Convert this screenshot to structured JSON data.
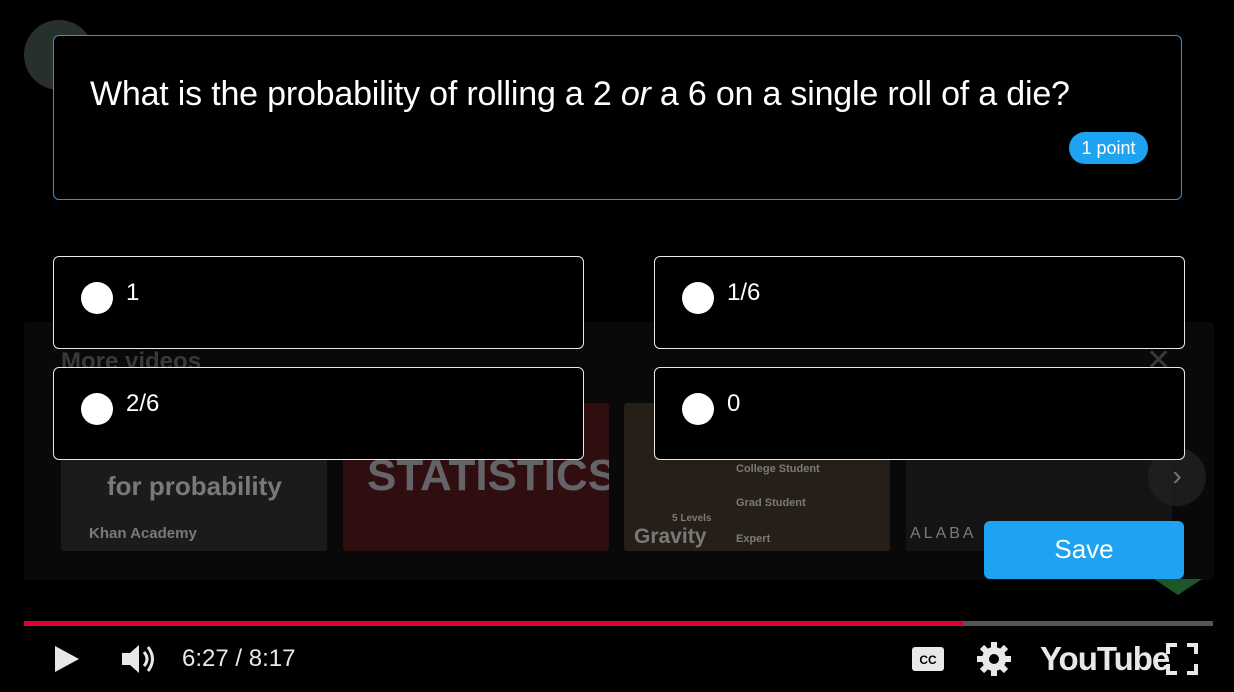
{
  "quiz": {
    "question_parts": {
      "before": "What is the probability of rolling a 2 ",
      "emphasis": "or",
      "after": " a 6 on a single roll of a die?"
    },
    "points": "1 point",
    "options": [
      {
        "label": "1"
      },
      {
        "label": "1/6"
      },
      {
        "label": "2/6"
      },
      {
        "label": "0"
      }
    ],
    "save_label": "Save"
  },
  "background_video": {
    "more_videos_title": "More videos",
    "thumbnails": [
      {
        "title": "for probability",
        "channel": "Khan Academy"
      },
      {
        "title": "STATISTICS?"
      },
      {
        "title": "Gravity",
        "levels": [
          "College Student",
          "Grad Student",
          "Expert"
        ],
        "badge": "5 Levels"
      },
      {
        "title": "ALABA"
      }
    ]
  },
  "player": {
    "time_display": "6:27 / 8:17",
    "brand": "YouTube",
    "progress_fraction": 0.79,
    "accent_color": "#e1002d",
    "icons": [
      "play-icon",
      "volume-icon",
      "captions-icon",
      "settings-gear-icon",
      "fullscreen-icon"
    ]
  },
  "colors": {
    "primary_blue": "#1ea3f2",
    "card_border": "#3b8ed6"
  }
}
